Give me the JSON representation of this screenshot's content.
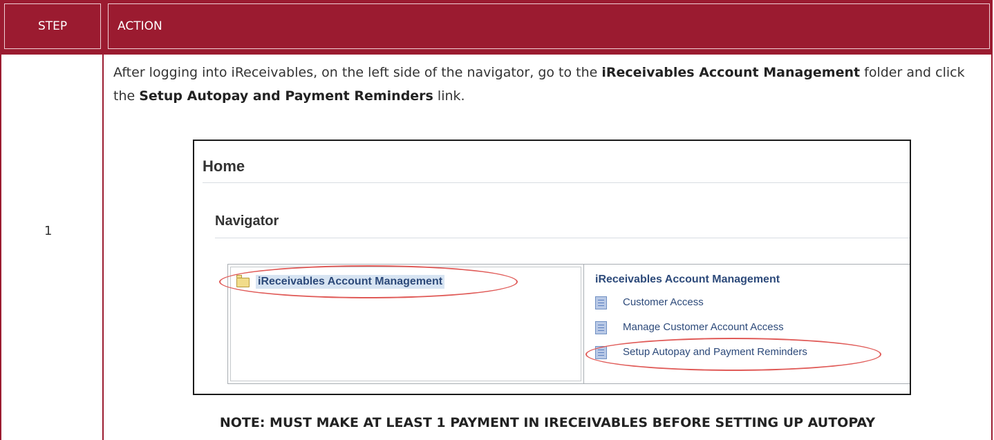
{
  "header": {
    "step_label": "STEP",
    "action_label": "ACTION"
  },
  "row": {
    "step_number": "1",
    "instruction": {
      "part1": "After logging into iReceivables, on the left side of the navigator, go to the ",
      "bold1": "iReceivables Account Management",
      "part2": " folder and click the ",
      "bold2": "Setup Autopay and Payment Reminders",
      "part3": " link."
    },
    "note": "NOTE: MUST MAKE AT LEAST 1 PAYMENT IN IRECEIVABLES BEFORE SETTING UP AUTOPAY"
  },
  "screenshot": {
    "title": "Home",
    "subtitle": "Navigator",
    "folder": {
      "icon": "folder-icon",
      "label": "iReceivables Account Management"
    },
    "panel": {
      "title": "iReceivables Account Management",
      "links": [
        {
          "icon": "document-icon",
          "label": "Customer Access"
        },
        {
          "icon": "document-icon",
          "label": "Manage Customer Account Access"
        },
        {
          "icon": "document-icon",
          "label": "Setup Autopay and Payment Reminders"
        }
      ]
    },
    "highlight_color": "#e05a57"
  },
  "colors": {
    "accent": "#9b1b30",
    "link": "#2d4a7a"
  }
}
